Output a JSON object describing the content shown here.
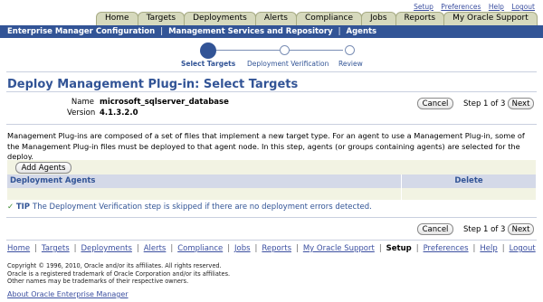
{
  "util_links": [
    "Setup",
    "Preferences",
    "Help",
    "Logout"
  ],
  "tabs": [
    "Home",
    "Targets",
    "Deployments",
    "Alerts",
    "Compliance",
    "Jobs",
    "Reports",
    "My Oracle Support"
  ],
  "breadcrumb": {
    "title": "Enterprise Manager Configuration",
    "items": [
      "Management Services and Repository",
      "Agents"
    ]
  },
  "train": {
    "steps": [
      "Select Targets",
      "Deployment Verification",
      "Review"
    ],
    "current": 0
  },
  "page": {
    "title": "Deploy Management Plug-in: Select Targets",
    "name_label": "Name",
    "name_value": "microsoft_sqlserver_database",
    "version_label": "Version",
    "version_value": "4.1.3.2.0",
    "cancel_label": "Cancel",
    "next_label": "Next",
    "step_text": "Step 1 of 3",
    "description": "Management Plug-ins are composed of a set of files that implement a new target type. For an agent to use a Management Plug-in, some of the Management Plug-in files must be deployed to that agent node. In this step, agents (or groups containing agents) are selected for the deploy.",
    "add_agents_label": "Add Agents",
    "table": {
      "columns": [
        "Deployment Agents",
        "Delete"
      ],
      "rows": []
    },
    "tip_label": "TIP",
    "tip_text": "The Deployment Verification step is skipped if there are no deployment errors detected."
  },
  "footer": {
    "links": [
      "Home",
      "Targets",
      "Deployments",
      "Alerts",
      "Compliance",
      "Jobs",
      "Reports",
      "My Oracle Support",
      "Setup",
      "Preferences",
      "Help",
      "Logout"
    ],
    "current": "Setup",
    "legal": [
      "Copyright © 1996, 2010, Oracle and/or its affiliates. All rights reserved.",
      "Oracle is a registered trademark of Oracle Corporation and/or its affiliates.",
      "Other names may be trademarks of their respective owners."
    ],
    "about": "About Oracle Enterprise Manager"
  },
  "colors": {
    "brand_blue": "#325496",
    "tab_bg": "#d6d9bd",
    "link": "#3b4fa0"
  }
}
